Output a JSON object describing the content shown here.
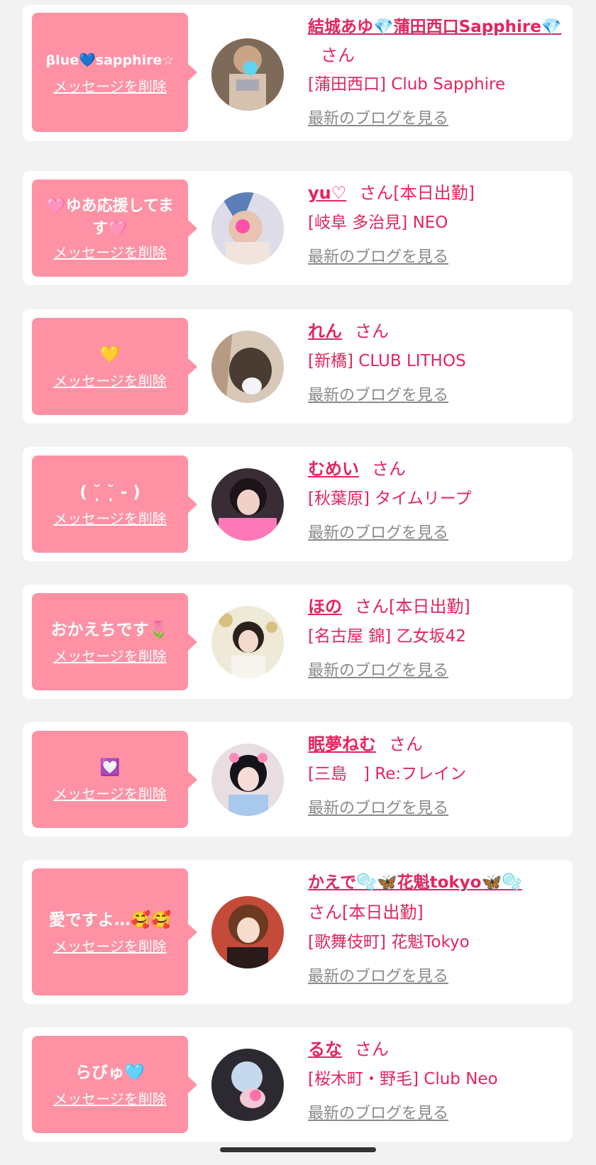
{
  "cards": [
    {
      "message": "βlue💙sapphire☆",
      "delete": "メッセージを削除",
      "name": "結城あゆ💎蒲田西口Sapphire💎",
      "honorific": "さん",
      "status": "",
      "shop": "[蒲田西口] Club Sapphire",
      "blog": "最新のブログを見る"
    },
    {
      "message": "🩷ゆあ応援してます🩷",
      "delete": "メッセージを削除",
      "name": "yu♡",
      "honorific": "さん",
      "status": "[本日出勤]",
      "shop": "[岐阜 多治見] NEO",
      "blog": "最新のブログを見る"
    },
    {
      "message": "💛",
      "delete": "メッセージを削除",
      "name": "れん",
      "honorific": "さん",
      "status": "",
      "shop": "[新橋] CLUB LITHOS",
      "blog": "最新のブログを見る"
    },
    {
      "message": "( ˘̩̩̩ ˘̩̩̩ - )",
      "delete": "メッセージを削除",
      "name": "むめい",
      "honorific": "さん",
      "status": "",
      "shop": "[秋葉原] タイムリープ",
      "blog": "最新のブログを見る"
    },
    {
      "message": "おかえちです🌷",
      "delete": "メッセージを削除",
      "name": "ほの",
      "honorific": "さん",
      "status": "[本日出勤]",
      "shop": "[名古屋 錦] 乙女坂42",
      "blog": "最新のブログを見る"
    },
    {
      "message": "💟",
      "delete": "メッセージを削除",
      "name": "眠夢ねむ",
      "honorific": "さん",
      "status": "",
      "shop": "[三島　] Re:フレイン",
      "blog": "最新のブログを見る"
    },
    {
      "message": "愛ですよ…🥰🥰",
      "delete": "メッセージを削除",
      "name": "かえで🫧🦋花魁tokyo🦋🫧",
      "honorific": "さん",
      "status": "[本日出勤]",
      "shop": "[歌舞伎町] 花魁Tokyo",
      "blog": "最新のブログを見る"
    },
    {
      "message": "らびゅ🩵",
      "delete": "メッセージを削除",
      "name": "るな",
      "honorific": "さん",
      "status": "",
      "shop": "[桜木町・野毛] Club Neo",
      "blog": "最新のブログを見る"
    }
  ],
  "colors": {
    "accent": "#e3255f",
    "bubble": "#ff91a4",
    "background": "#f2f2f2"
  }
}
